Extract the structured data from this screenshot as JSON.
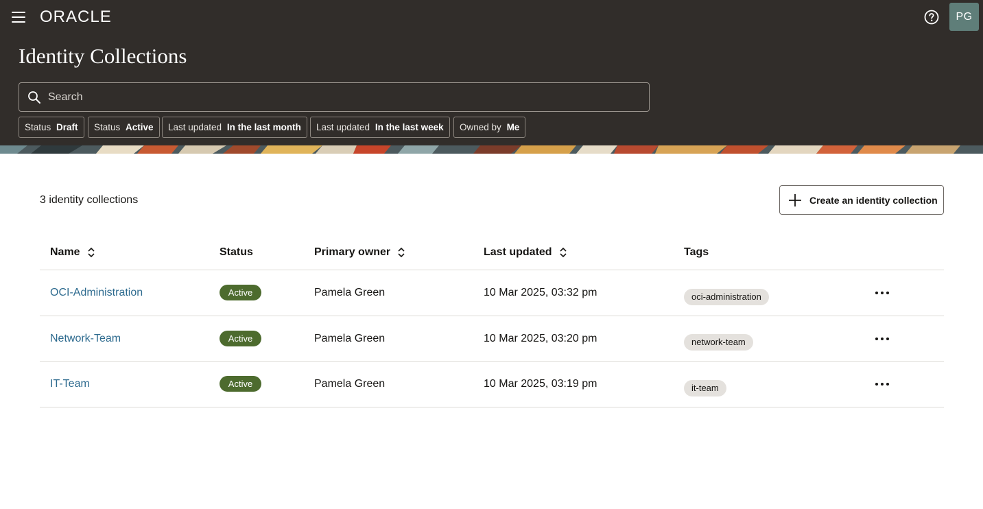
{
  "header": {
    "title": "Identity Collections",
    "logo_text": "ORACLE",
    "avatar_initials": "PG",
    "search": {
      "placeholder": "Search",
      "value": ""
    },
    "filters": [
      {
        "label": "Status",
        "value": "Draft"
      },
      {
        "label": "Status",
        "value": "Active"
      },
      {
        "label": "Last updated",
        "value": "In the last month"
      },
      {
        "label": "Last updated",
        "value": "In the last week"
      },
      {
        "label": "Owned by",
        "value": "Me"
      }
    ]
  },
  "main": {
    "count_text": "3 identity collections",
    "create_button": "Create an identity collection",
    "columns": [
      "Name",
      "Status",
      "Primary owner",
      "Last updated",
      "Tags"
    ],
    "rows": [
      {
        "name": "OCI-Administration",
        "status": "Active",
        "owner": "Pamela Green",
        "updated": "10 Mar 2025, 03:32 pm",
        "tag": "oci-administration"
      },
      {
        "name": "Network-Team",
        "status": "Active",
        "owner": "Pamela Green",
        "updated": "10 Mar 2025, 03:20 pm",
        "tag": "network-team"
      },
      {
        "name": "IT-Team",
        "status": "Active",
        "owner": "Pamela Green",
        "updated": "10 Mar 2025, 03:19 pm",
        "tag": "it-team"
      }
    ]
  },
  "icons": {
    "menu": "hamburger-menu-icon",
    "help": "help-icon",
    "search": "search-icon",
    "create": "plus-icon",
    "sort": "sort-icon",
    "row_actions": "more-actions-icon"
  },
  "colors": {
    "header_bg": "#312d2a",
    "link": "#2e6b8f",
    "status_active": "#4d6b2e",
    "tag_bg": "#e4e1dd"
  }
}
